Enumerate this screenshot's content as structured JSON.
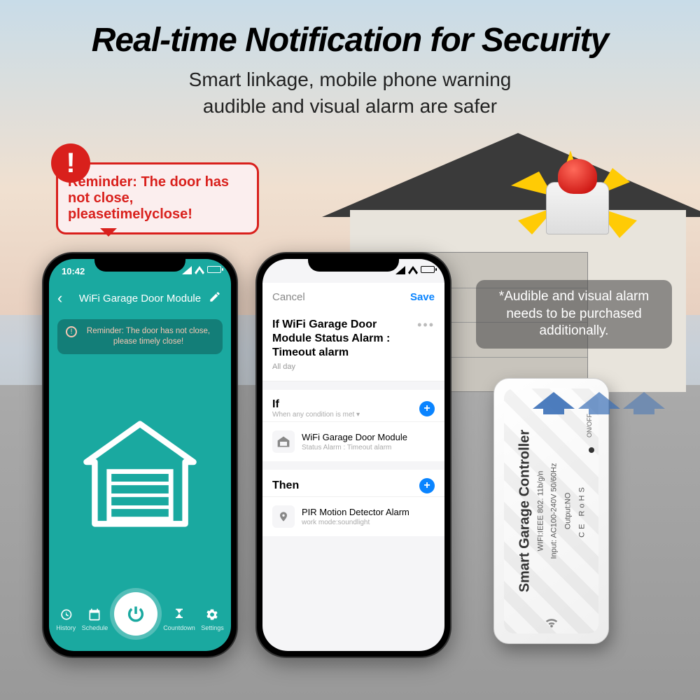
{
  "headline": "Real-time Notification for Security",
  "subhead_line1": "Smart linkage, mobile phone warning",
  "subhead_line2": "audible and visual alarm are safer",
  "reminder_bubble": "Reminder: The door has not close, pleasetimelyclose!",
  "phone1": {
    "time": "10:42",
    "title": "WiFi Garage Door Module",
    "alert": "Reminder: The door has not close, please timely close!",
    "bottom": {
      "history": "History",
      "schedule": "Schedule",
      "countdown": "Countdown",
      "settings": "Settings"
    }
  },
  "phone2": {
    "cancel": "Cancel",
    "save": "Save",
    "title": "If WiFi Garage Door Module Status Alarm : Timeout alarm",
    "subtitle": "All day",
    "if_label": "If",
    "if_condition": "When any condition is met ▾",
    "if_card_title": "WiFi Garage Door Module",
    "if_card_sub": "Status Alarm : Timeout alarm",
    "then_label": "Then",
    "then_card_title": "PIR Motion Detector Alarm",
    "then_card_sub": "work mode:soundlight"
  },
  "alarm_note": "*Audible and visual alarm needs to be purchased additionally.",
  "controller": {
    "title": "Smart Garage Controller",
    "wifi_spec": "WIFI:IEEE 802. 11b/g/n",
    "input_spec": "Input: AC100-240V 50/60Hz",
    "output_spec": "Output:NO",
    "marks": "CE   RoHS",
    "onoff": "ON/OFF"
  }
}
